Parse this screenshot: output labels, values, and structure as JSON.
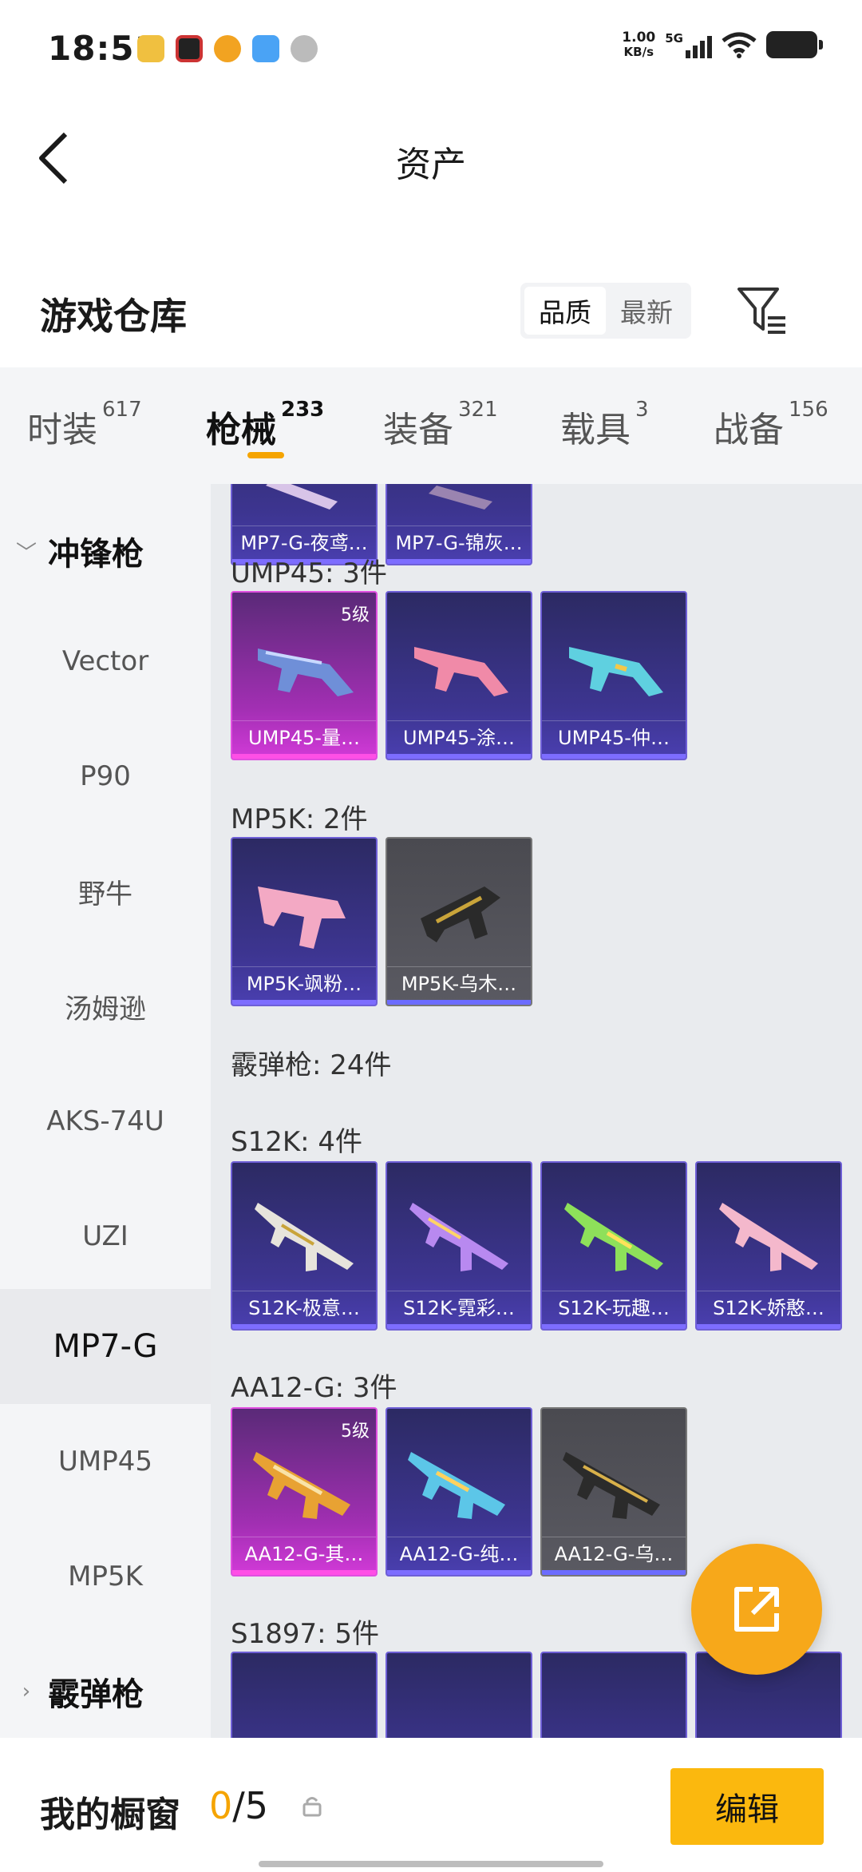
{
  "status_bar": {
    "time": "18:51",
    "net_speed_value": "1.00",
    "net_speed_unit": "KB/s",
    "network": "5G",
    "app_icons": [
      "app-icon-1",
      "app-icon-2",
      "app-icon-3",
      "app-icon-4",
      "app-icon-5"
    ]
  },
  "header": {
    "back_icon": "chevron-left-icon",
    "title": "资产"
  },
  "section": {
    "title": "游戏仓库",
    "sort_options": [
      "品质",
      "最新"
    ],
    "sort_selected": "品质",
    "filter_icon": "filter-icon"
  },
  "tabs": [
    {
      "label": "时装",
      "count": "617"
    },
    {
      "label": "枪械",
      "count": "233",
      "active": true
    },
    {
      "label": "装备",
      "count": "321"
    },
    {
      "label": "载具",
      "count": "3"
    },
    {
      "label": "战备",
      "count": "156"
    }
  ],
  "sidebar": {
    "group_open": "冲锋枪",
    "items": [
      "Vector",
      "P90",
      "野牛",
      "汤姆逊",
      "AKS-74U",
      "UZI",
      "MP7-G",
      "UMP45",
      "MP5K"
    ],
    "selected": "MP7-G",
    "group_closed": "霰弹枪"
  },
  "content": {
    "mp7_cards": [
      "MP7-G-夜鸢…",
      "MP7-G-锦灰…"
    ],
    "ump45_label": "UMP45: 3件",
    "ump45_cards": [
      {
        "name": "UMP45-量…",
        "level": "5级"
      },
      {
        "name": "UMP45-涂…"
      },
      {
        "name": "UMP45-仲…"
      }
    ],
    "mp5k_label": "MP5K: 2件",
    "mp5k_cards": [
      {
        "name": "MP5K-飒粉…"
      },
      {
        "name": "MP5K-乌木…"
      }
    ],
    "shotgun_label": "霰弹枪: 24件",
    "s12k_label": "S12K: 4件",
    "s12k_cards": [
      {
        "name": "S12K-极意…"
      },
      {
        "name": "S12K-霓彩…"
      },
      {
        "name": "S12K-玩趣…"
      },
      {
        "name": "S12K-娇憨…"
      }
    ],
    "aa12_label": "AA12-G: 3件",
    "aa12_cards": [
      {
        "name": "AA12-G-其…",
        "level": "5级"
      },
      {
        "name": "AA12-G-纯…"
      },
      {
        "name": "AA12-G-乌…"
      }
    ],
    "s1897_label": "S1897: 5件"
  },
  "fab": {
    "icon": "share-external-icon"
  },
  "bottom_bar": {
    "title": "我的橱窗",
    "count_current": "0",
    "count_total": "/5",
    "lock_icon": "lock-icon",
    "edit_label": "编辑"
  },
  "colors": {
    "accent": "#f5a400",
    "edit_button": "#fbb80e",
    "fab": "#f7a81a"
  }
}
